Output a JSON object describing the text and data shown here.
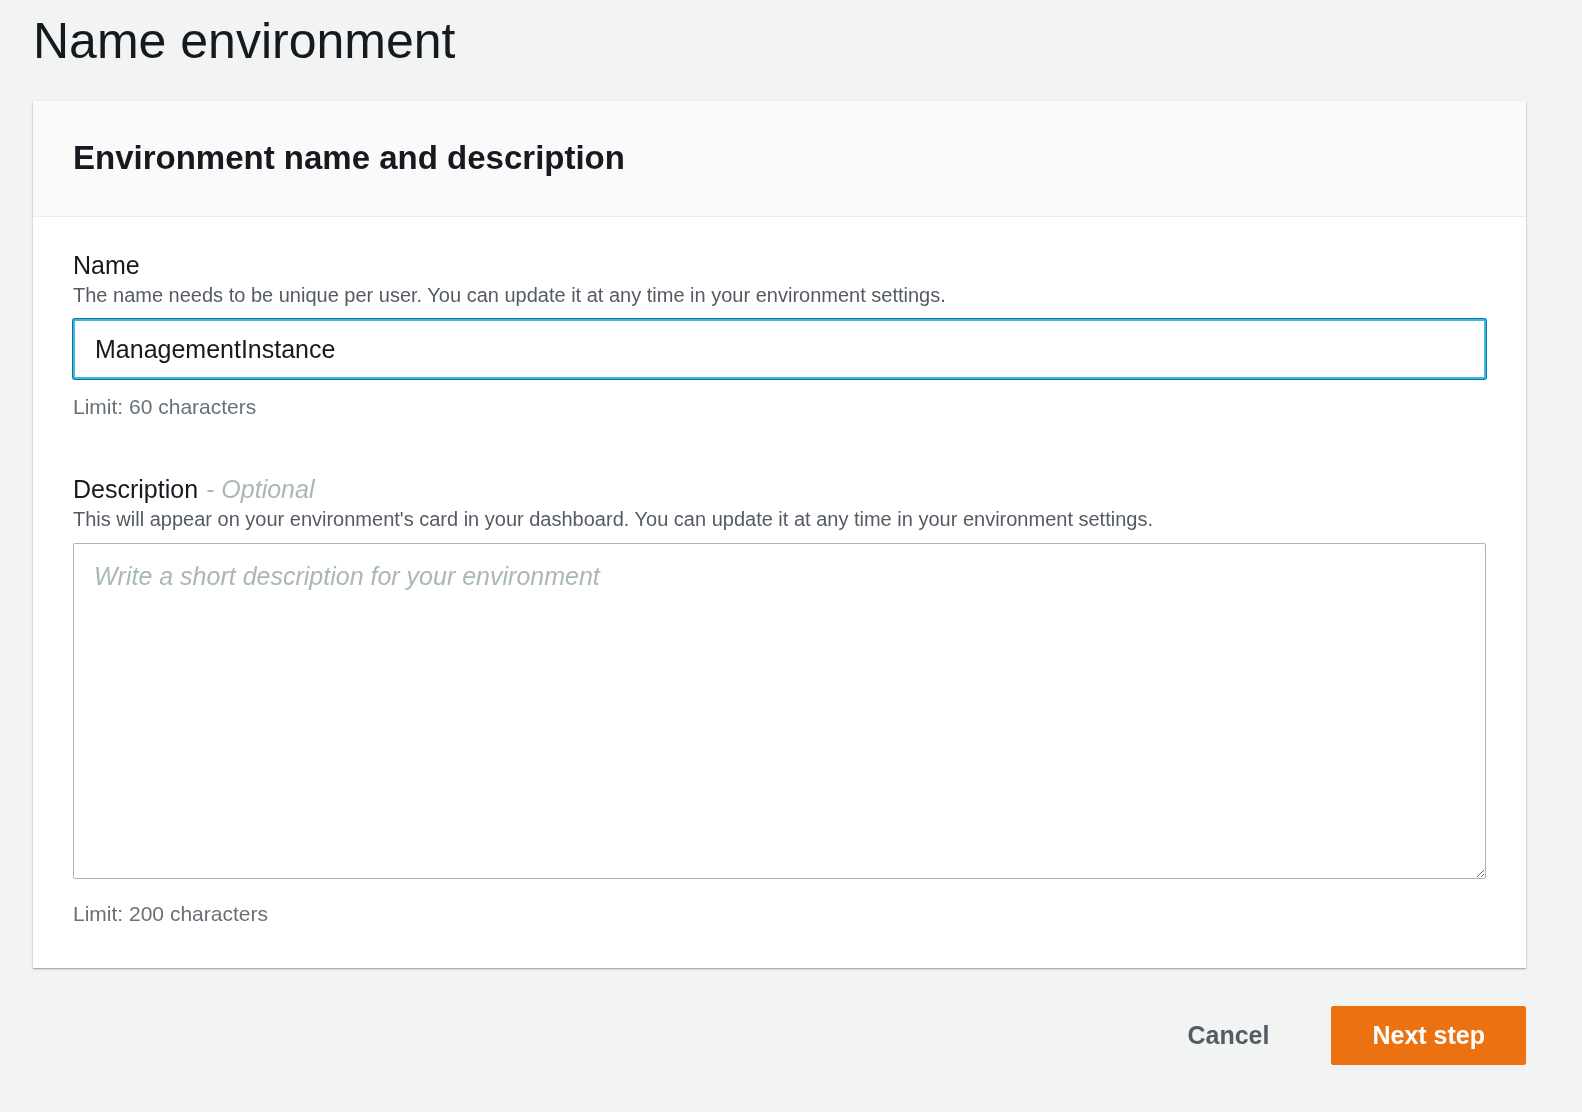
{
  "page_title": "Name environment",
  "card": {
    "title": "Environment name and description",
    "fields": [
      {
        "kind": "input",
        "label": "Name",
        "description": "The name needs to be unique per user. You can update it at any time in your environment settings.",
        "value": "ManagementInstance",
        "focused": true,
        "constraint": "Limit: 60 characters"
      },
      {
        "kind": "textarea",
        "label": "Description",
        "optional_tag": "- Optional",
        "description": "This will appear on your environment's card in your dashboard. You can update it at any time in your environment settings.",
        "placeholder": "Write a short description for your environment",
        "focused": false,
        "constraint": "Limit: 200 characters"
      }
    ]
  },
  "buttons": [
    {
      "kind": "link",
      "label": "Cancel"
    },
    {
      "kind": "primary",
      "label": "Next step"
    }
  ]
}
